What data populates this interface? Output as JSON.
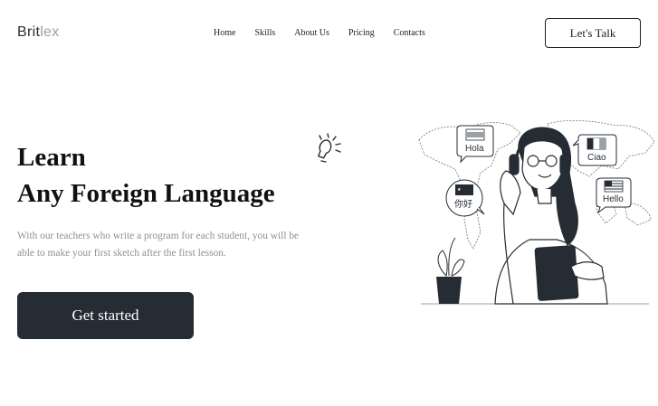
{
  "header": {
    "logo_part1": "Brit",
    "logo_part2": "lex",
    "nav": [
      "Home",
      "Skills",
      "About Us",
      "Pricing",
      "Contacts"
    ],
    "cta_label": "Let's Talk"
  },
  "hero": {
    "title_line1": "Learn",
    "title_line2": "Any Foreign Language",
    "subtitle": "With our teachers who write a program for each student, you will be able to make your first sketch after the first lesson.",
    "button_label": "Get started"
  },
  "illustration": {
    "bubbles": [
      "Hola",
      "Ciao",
      "你好",
      "Hello"
    ],
    "ink_color": "#252c33"
  }
}
